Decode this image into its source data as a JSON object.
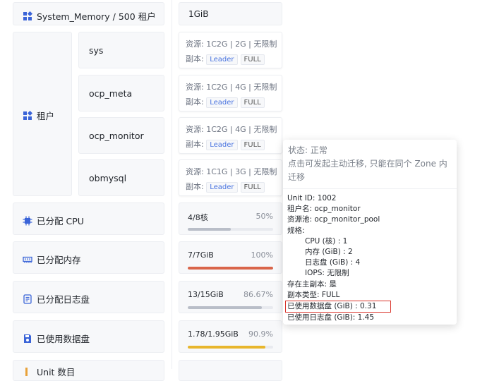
{
  "top": {
    "label": "System_Memory / 500 租户",
    "value": "1GiB"
  },
  "tenant": {
    "label": "租户",
    "items": [
      {
        "name": "sys",
        "resource": "资源: 1C2G | 2G | 无限制",
        "replica_label": "副本:",
        "tags": [
          "Leader",
          "FULL"
        ]
      },
      {
        "name": "ocp_meta",
        "resource": "资源: 1C2G | 4G | 无限制",
        "replica_label": "副本:",
        "tags": [
          "Leader",
          "FULL"
        ]
      },
      {
        "name": "ocp_monitor",
        "resource": "资源: 1C2G | 4G | 无限制",
        "replica_label": "副本:",
        "tags": [
          "Leader",
          "FULL"
        ]
      },
      {
        "name": "obmysql",
        "resource": "资源: 1C1G | 3G | 无限制",
        "replica_label": "副本:",
        "tags": [
          "Leader",
          "FULL"
        ]
      }
    ]
  },
  "metrics": [
    {
      "label": "已分配 CPU",
      "icon": "cpu-icon",
      "ratio": "4/8核",
      "percent": "50%",
      "fill": 0.5,
      "color": "#b9bec8"
    },
    {
      "label": "已分配内存",
      "icon": "memory-icon",
      "ratio": "7/7GiB",
      "percent": "100%",
      "fill": 1.0,
      "color": "#d9654a"
    },
    {
      "label": "已分配日志盘",
      "icon": "log-disk-icon",
      "ratio": "13/15GiB",
      "percent": "86.67%",
      "fill": 0.8667,
      "color": "#b9bec8"
    },
    {
      "label": "已使用数据盘",
      "icon": "data-disk-icon",
      "ratio": "1.78/1.95GiB",
      "percent": "90.9%",
      "fill": 0.909,
      "color": "#e8b62c"
    }
  ],
  "bottom_partial": {
    "label": "Unit 数目"
  },
  "tooltip": {
    "status": "状态: 正常",
    "hint": "点击可发起主动迁移, 只能在同个 Zone 内迁移",
    "unit_id": "Unit ID: 1002",
    "tenant_name": "租户名: ocp_monitor",
    "pool": "资源池: ocp_monitor_pool",
    "spec_label": "规格:",
    "cpu": "CPU (核) : 1",
    "memory": "内存 (GiB) : 2",
    "log_disk": "日志盘 (GiB) : 4",
    "iops": "IOPS: 无限制",
    "has_leader": "存在主副本: 是",
    "replica_type": "副本类型: FULL",
    "data_disk_used": "已使用数据盘 (GiB) : 0.31",
    "log_disk_used": "已使用日志盘 (GiB): 1.45"
  },
  "colors": {
    "accent": "#3a64d8",
    "highlight": "#d9342b"
  }
}
